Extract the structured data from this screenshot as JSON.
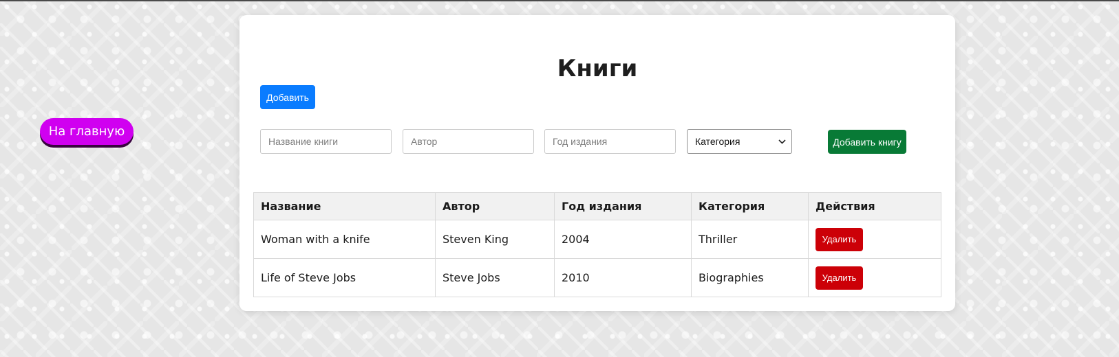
{
  "nav": {
    "home_label": "На главную"
  },
  "page": {
    "title": "Книги"
  },
  "toolbar": {
    "add_label": "Добавить"
  },
  "form": {
    "title_placeholder": "Название книги",
    "author_placeholder": "Автор",
    "year_placeholder": "Год издания",
    "category_selected": "Категория",
    "submit_label": "Добавить книгу"
  },
  "table": {
    "headers": [
      "Название",
      "Автор",
      "Год издания",
      "Категория",
      "Действия"
    ],
    "rows": [
      {
        "title": "Woman with a knife",
        "author": "Steven King",
        "year": "2004",
        "category": "Thriller",
        "action": "Удалить"
      },
      {
        "title": "Life of Steve Jobs",
        "author": "Steve Jobs",
        "year": "2010",
        "category": "Biographies",
        "action": "Удалить"
      }
    ]
  },
  "icons": {
    "select_arrow": "chevron-down-icon"
  },
  "colors": {
    "home_button": "#d000f0",
    "add_button": "#0a7cff",
    "submit_button": "#087a36",
    "delete_button": "#cc0007"
  }
}
